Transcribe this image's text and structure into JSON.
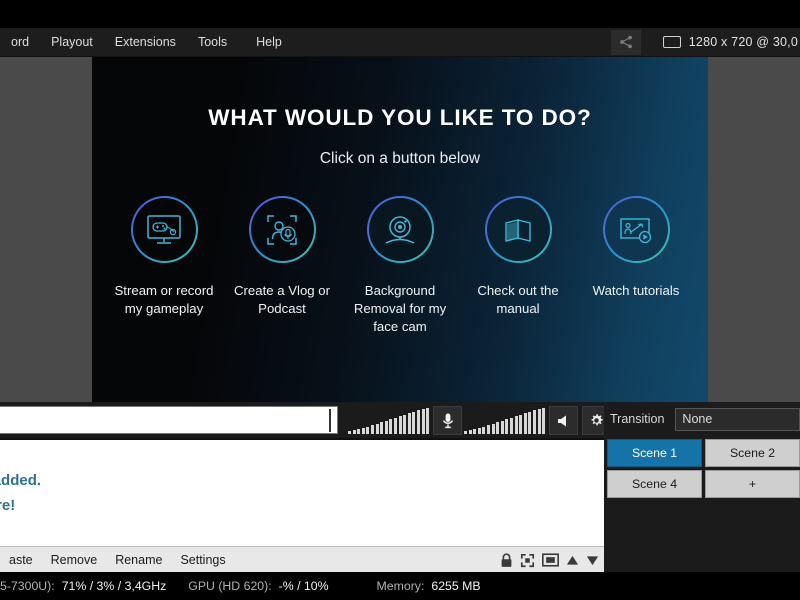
{
  "menubar": {
    "items": [
      {
        "label": "ord",
        "name": "menu-record"
      },
      {
        "label": "Playout",
        "name": "menu-playout"
      },
      {
        "label": "Extensions",
        "name": "menu-extensions"
      },
      {
        "label": "Tools",
        "name": "menu-tools"
      },
      {
        "label": "Help",
        "name": "menu-help"
      }
    ],
    "share_icon": "share-icon",
    "monitor_icon": "monitor-icon",
    "resolution": "1280 x 720 @ 30,0"
  },
  "welcome": {
    "title": "WHAT WOULD YOU LIKE TO DO?",
    "subtitle": "Click on a button below",
    "buttons": [
      {
        "label": "Stream or record my gameplay",
        "icon": "gameplay-monitor-icon"
      },
      {
        "label": "Create a Vlog or Podcast",
        "icon": "vlog-person-mic-icon"
      },
      {
        "label": "Background Removal for my face cam",
        "icon": "webcam-icon"
      },
      {
        "label": "Check out the manual",
        "icon": "book-manual-icon"
      },
      {
        "label": "Watch tutorials",
        "icon": "tutorial-play-icon"
      }
    ]
  },
  "audiobar": {
    "timeline_value": "",
    "mic_icon": "microphone-icon",
    "speaker_icon": "speaker-icon",
    "settings_icon": "gear-icon"
  },
  "transition": {
    "label": "Transition",
    "value": "None"
  },
  "scenes": {
    "items": [
      {
        "label": "Scene 1",
        "active": true
      },
      {
        "label": "Scene 2",
        "active": false
      },
      {
        "label": "Scene 4",
        "active": false
      },
      {
        "label": "+",
        "active": false
      }
    ]
  },
  "sources": {
    "empty_line1": "rce added.",
    "empty_line2": "e here!",
    "toolbar": [
      {
        "label": "aste",
        "name": "source-paste"
      },
      {
        "label": "Remove",
        "name": "source-remove"
      },
      {
        "label": "Rename",
        "name": "source-rename"
      },
      {
        "label": "Settings",
        "name": "source-settings"
      }
    ],
    "icons": [
      "lock-icon",
      "fit-screen-icon",
      "window-frame-icon",
      "move-up-icon",
      "move-down-icon"
    ]
  },
  "statusbar": {
    "cpu_key": "5-7300U):",
    "cpu_value": "71% / 3% / 3,4GHz",
    "gpu_key": "GPU (HD 620):",
    "gpu_value": "-% / 10%",
    "memory_key": "Memory:",
    "memory_value": "6255 MB"
  },
  "colors": {
    "accent": "#1573a8",
    "source_text": "#2d7391",
    "panel": "#1b1b1b"
  }
}
